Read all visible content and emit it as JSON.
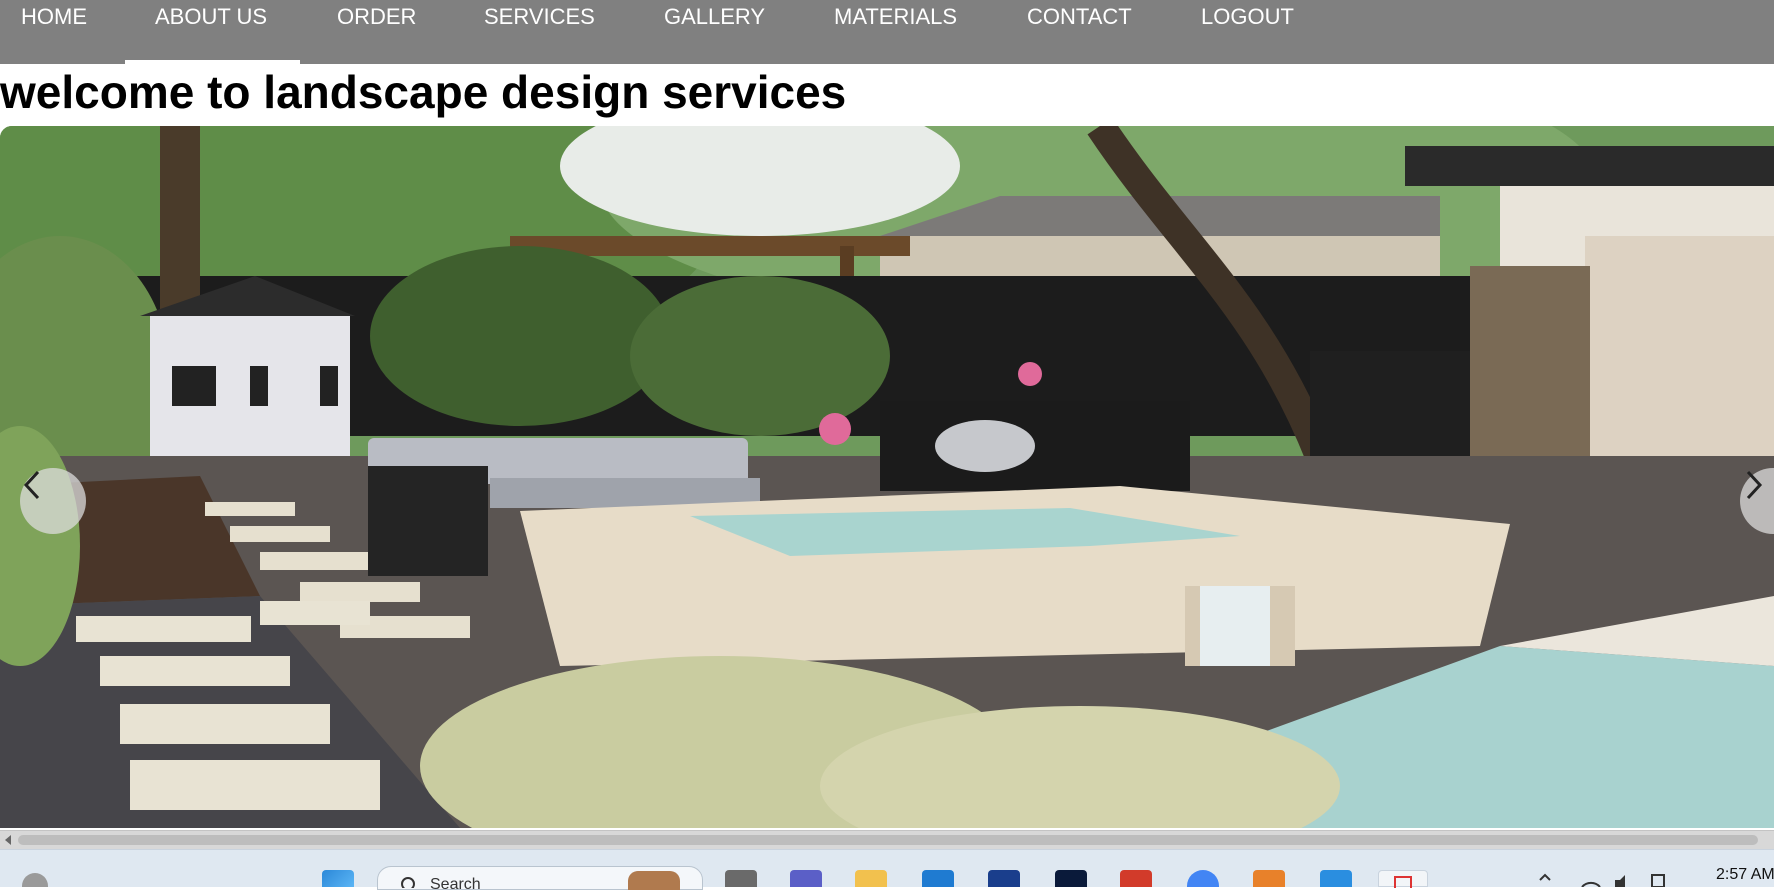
{
  "nav": {
    "items": [
      {
        "label": "HOME"
      },
      {
        "label": "ABOUT US",
        "active": true
      },
      {
        "label": "ORDER"
      },
      {
        "label": "SERVICES"
      },
      {
        "label": "GALLERY"
      },
      {
        "label": "MATERIALS"
      },
      {
        "label": "CONTACT"
      },
      {
        "label": "LOGOUT"
      }
    ]
  },
  "page": {
    "heading": "welcome to landscape design services"
  },
  "carousel": {
    "prev_icon": "chevron-left-icon",
    "next_icon": "chevron-right-icon"
  },
  "taskbar": {
    "search_placeholder": "Search",
    "clock": "2:57 AM"
  },
  "colors": {
    "nav_bg": "#808080",
    "nav_text": "#ffffff",
    "heading": "#000000",
    "taskbar_bg": "#dfe8f1"
  }
}
